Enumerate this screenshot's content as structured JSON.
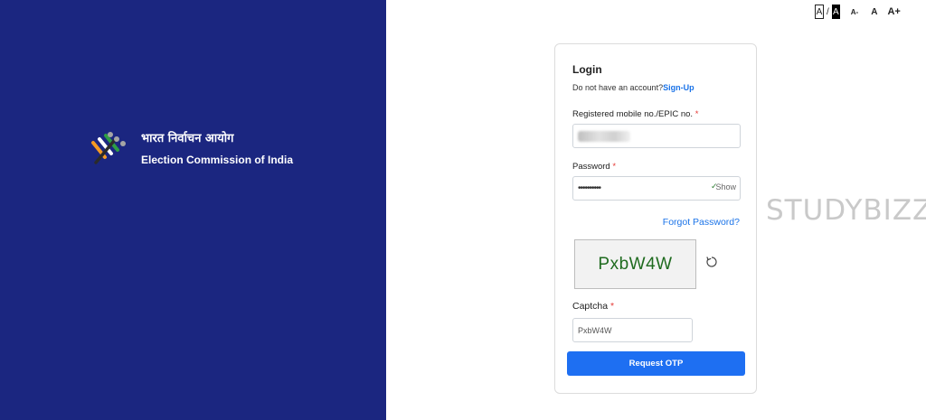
{
  "brand": {
    "name_hindi": "भारत निर्वाचन आयोग",
    "name_english": "Election Commission of India"
  },
  "font_controls": {
    "light_theme": "A",
    "separator": "/",
    "dark_theme": "A",
    "decrease": "A-",
    "normal": "A",
    "increase": "A+"
  },
  "watermark": "STUDYBIZZ",
  "login": {
    "title": "Login",
    "no_account_text": "Do not have an account?",
    "signup_label": "Sign-Up",
    "mobile_label": "Registered mobile no./EPIC no.",
    "required_mark": "*",
    "password_label": "Password",
    "password_value": "••••••••••",
    "show_label": "Show",
    "forgot_label": "Forgot Password?",
    "captcha_image_text": "PxbW4W",
    "captcha_label": "Captcha",
    "captcha_value": "PxbW4W",
    "submit_label": "Request OTP"
  },
  "colors": {
    "brand_panel": "#1b2680",
    "primary_button": "#1e6ff2",
    "link": "#1a73e8",
    "required": "#e53935"
  }
}
